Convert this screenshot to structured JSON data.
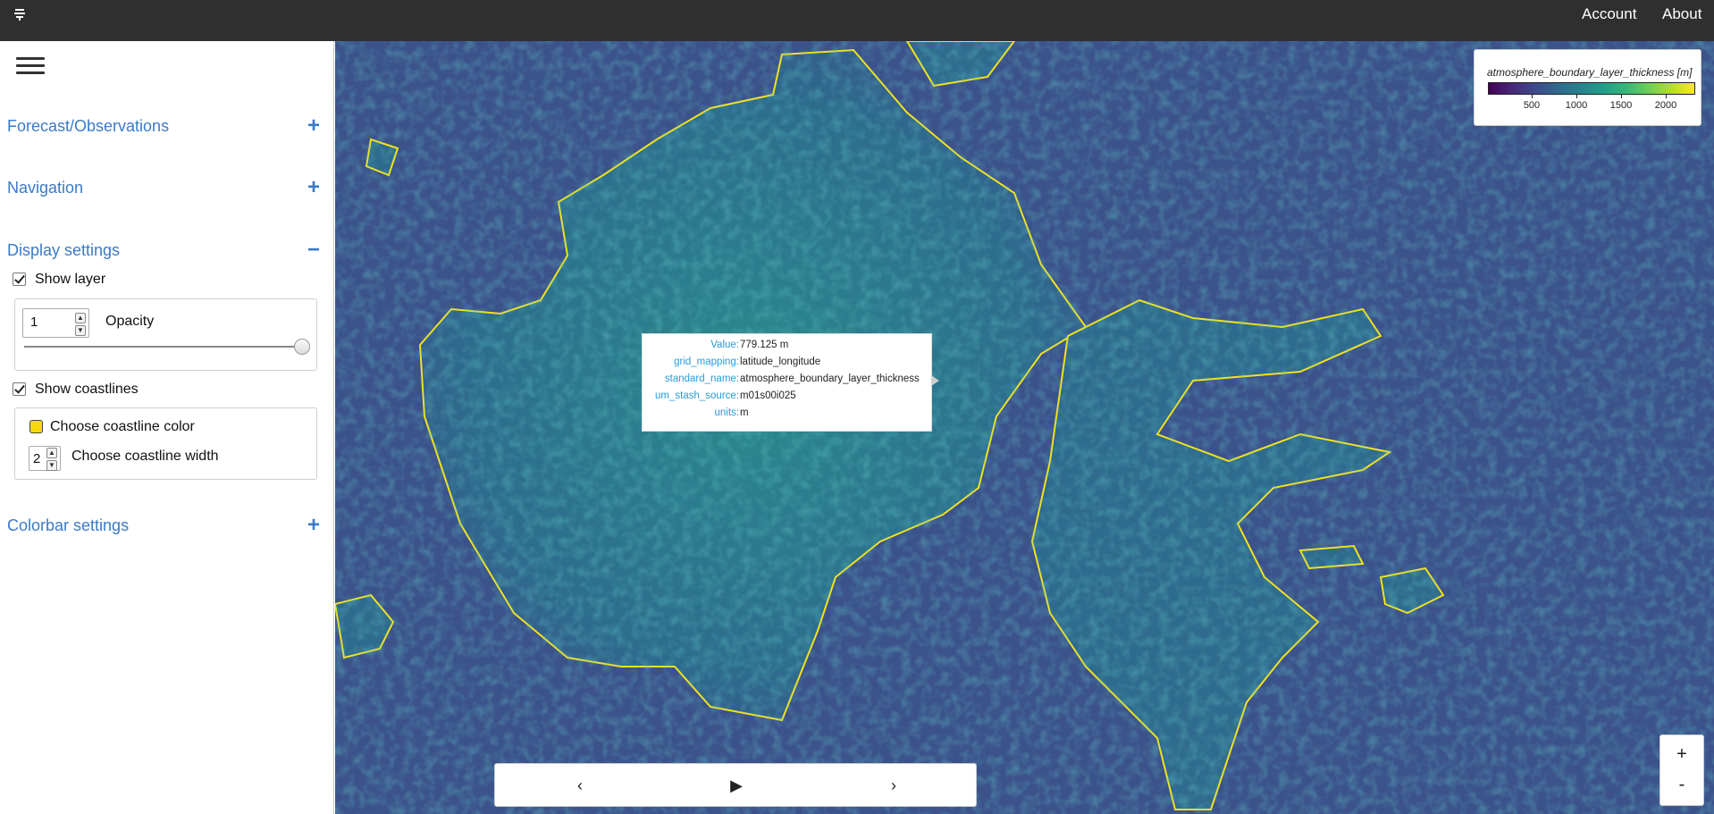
{
  "topbar": {
    "account_label": "Account",
    "about_label": "About",
    "logo_icon": "satellite-dish-icon"
  },
  "sidebar": {
    "menu_icon": "hamburger-menu-icon",
    "sections": {
      "forecast": {
        "title": "Forecast/Observations",
        "toggle": "+"
      },
      "navigation": {
        "title": "Navigation",
        "toggle": "+"
      },
      "display": {
        "title": "Display settings",
        "toggle": "−"
      },
      "colorbar": {
        "title": "Colorbar settings",
        "toggle": "+"
      }
    },
    "display_settings": {
      "show_layer": {
        "label": "Show layer",
        "checked": true
      },
      "opacity": {
        "value": "1",
        "label": "Opacity",
        "slider_fraction": 1.0
      },
      "show_coastlines": {
        "label": "Show coastlines",
        "checked": true
      },
      "coastline_color": {
        "label": "Choose coastline color",
        "color": "#f5d90a"
      },
      "coastline_width": {
        "value": "2",
        "label": "Choose coastline width"
      }
    }
  },
  "legend": {
    "title": "atmosphere_boundary_layer_thickness [m]",
    "ticks": [
      "500",
      "1000",
      "1500",
      "2000"
    ],
    "colormap": [
      "#440154",
      "#3e4989",
      "#26828e",
      "#35b779",
      "#fde725"
    ]
  },
  "tooltip": {
    "rows": [
      {
        "key": "Value:",
        "value": "779.125 m"
      },
      {
        "key": "grid_mapping:",
        "value": "latitude_longitude"
      },
      {
        "key": "standard_name:",
        "value": "atmosphere_boundary_layer_thickness"
      },
      {
        "key": "um_stash_source:",
        "value": "m01s00i025"
      },
      {
        "key": "units:",
        "value": "m"
      }
    ]
  },
  "timebar": {
    "prev": "‹",
    "play": "▶",
    "next": "›"
  },
  "zoom": {
    "in": "+",
    "out": "-"
  },
  "colors": {
    "accent": "#3b7ac8",
    "topbar": "#2f2f2f",
    "coastline": "#f5d90a",
    "tooltip_key": "#2a9bd6"
  }
}
